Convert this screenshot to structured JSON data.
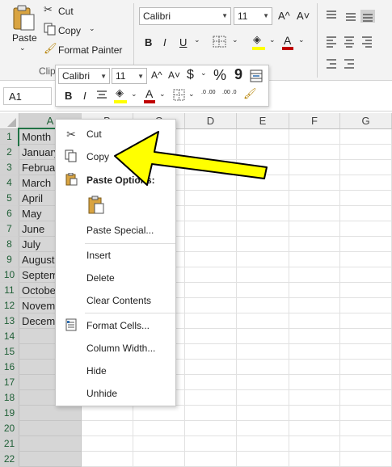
{
  "ribbon": {
    "paste_label": "Paste",
    "cut_label": "Cut",
    "copy_label": "Copy",
    "format_painter_label": "Format Painter",
    "clipboard_group_label": "Clip",
    "font_name": "Calibri",
    "font_size": "11",
    "bold": "B",
    "italic": "I",
    "underline": "U",
    "grow_font": "A^",
    "shrink_font": "A˅",
    "font_color_glyph": "A"
  },
  "formula_bar": {
    "name_box": "A1"
  },
  "mini_toolbar": {
    "font_name": "Calibri",
    "font_size": "11",
    "grow_font": "A^",
    "shrink_font": "A˅",
    "currency": "$",
    "percent": "%",
    "comma": "9",
    "bold": "B",
    "italic": "I",
    "font_color_glyph": "A",
    "increase_decimal": ".0 .00",
    "decrease_decimal": ".00 .0"
  },
  "columns": [
    "A",
    "B",
    "C",
    "D",
    "E",
    "F",
    "G"
  ],
  "rows": [
    "1",
    "2",
    "3",
    "4",
    "5",
    "6",
    "7",
    "8",
    "9",
    "10",
    "11",
    "12",
    "13",
    "14",
    "15",
    "16",
    "17",
    "18",
    "19",
    "20",
    "21",
    "22"
  ],
  "cells_a": [
    "Month",
    "January",
    "February",
    "March",
    "April",
    "May",
    "June",
    "July",
    "August",
    "September",
    "October",
    "November",
    "December",
    "",
    "",
    "",
    "",
    "",
    "",
    "",
    "",
    ""
  ],
  "context_menu": {
    "cut": "Cut",
    "copy": "Copy",
    "paste_options": "Paste Options:",
    "paste_special": "Paste Special...",
    "insert": "Insert",
    "delete": "Delete",
    "clear_contents": "Clear Contents",
    "format_cells": "Format Cells...",
    "column_width": "Column Width...",
    "hide": "Hide",
    "unhide": "Unhide"
  },
  "colors": {
    "arrow_fill": "#ffff00",
    "arrow_stroke": "#000000",
    "excel_green": "#217346",
    "fill_yellow": "#ffff00",
    "font_red": "#c00000"
  },
  "icons": [
    "scissors-icon",
    "copy-icon",
    "clipboard-icon",
    "format-painter-icon",
    "paint-bucket-icon",
    "borders-icon",
    "merge-icon",
    "font-color-icon",
    "align-icon"
  ]
}
